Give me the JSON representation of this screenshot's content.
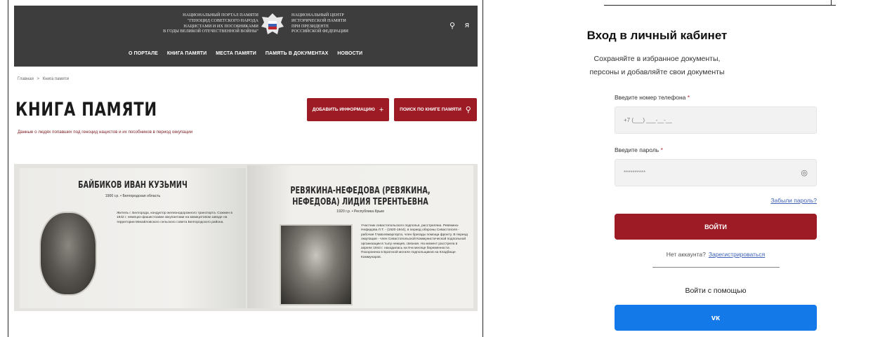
{
  "left": {
    "header": {
      "portal_lines": [
        "НАЦИОНАЛЬНЫЙ ПОРТАЛ ПАМЯТИ",
        "\"ГЕНОЦИД СОВЕТСКОГО НАРОДА",
        "НАЦИСТАМИ И ИХ ПОСОБНИКАМИ",
        "В ГОДЫ ВЕЛИКОЙ ОТЕЧЕСТВЕННОЙ ВОЙНЫ\""
      ],
      "center_lines": [
        "НАЦИОНАЛЬНЫЙ ЦЕНТР",
        "ИСТОРИЧЕСКОЙ ПАМЯТИ",
        "ПРИ ПРЕЗИДЕНТЕ",
        "РОССИЙСКОЙ ФЕДЕРАЦИИ"
      ],
      "search_icon": "⚲",
      "user_icon": "ᴙ",
      "nav": [
        "О ПОРТАЛЕ",
        "КНИГА ПАМЯТИ",
        "МЕСТА ПАМЯТИ",
        "ПАМЯТЬ В ДОКУМЕНТАХ",
        "НОВОСТИ"
      ]
    },
    "breadcrumb": {
      "home": "Главная",
      "sep": ">",
      "current": "Книга памяти"
    },
    "title": "КНИГА ПАМЯТИ",
    "add_button": "ДОБАВИТЬ ИНФОРМАЦИЮ",
    "search_button": "ПОИСК ПО КНИГЕ ПАМЯТИ",
    "subtitle": "Данные о людях попавших под геноцид нацистов и их пособников в период оккупации",
    "persons": [
      {
        "name": "БАЙБИКОВ ИВАН КУЗЬМИЧ",
        "meta": "1900 г.р. • Белгородская область",
        "bio": "Житель г. Белгорода, кондуктор железнодорожного транспорта. Сожжен в 1942 г. немецко-фашистскими оккупантами на кимицитовом заводе на территории Михайловского сельского совета Белгородского района."
      },
      {
        "name": "РЕВЯКИНА-НЕФЕДОВА (РЕВЯКИНА, НЕФЕДОВА) ЛИДИЯ ТЕРЕНТЬЕВНА",
        "meta": "1920 г.р. • Республика Крым",
        "bio": "Участник севастопольского подполья, расстреляна. Ревякина-Нефедова Л.Т. - (1920-1944), в период обороны Севастополя - рабочая Главсевморпорта, член бригады помощи фронту. В период оккупации - член Севастопольской Коммунистической подпольной организации в тылу немцев, связная. На момент расстрела в апреле 1944 г. находилась на 9-м месяце беременности. Похоронена в Братской могиле подпольщиков на Кладбище Коммунаров."
      }
    ]
  },
  "login": {
    "title": "Вход в личный кабинет",
    "description_line1": "Сохраняйте в избранное документы,",
    "description_line2": "персоны и добавляйте свои документы",
    "phone_label": "Введите номер телефона",
    "phone_placeholder": "+7 (___) ___-__-__",
    "password_label": "Введите пароль",
    "password_value": "**********",
    "required_mark": "*",
    "forgot": "Забыли пароль?",
    "login_button": "ВОЙТИ",
    "no_account": "Нет аккаунта?",
    "register": "Зарегистрироваться",
    "login_with": "Войти с помощью",
    "vk_button": "ᴠᴋ"
  }
}
